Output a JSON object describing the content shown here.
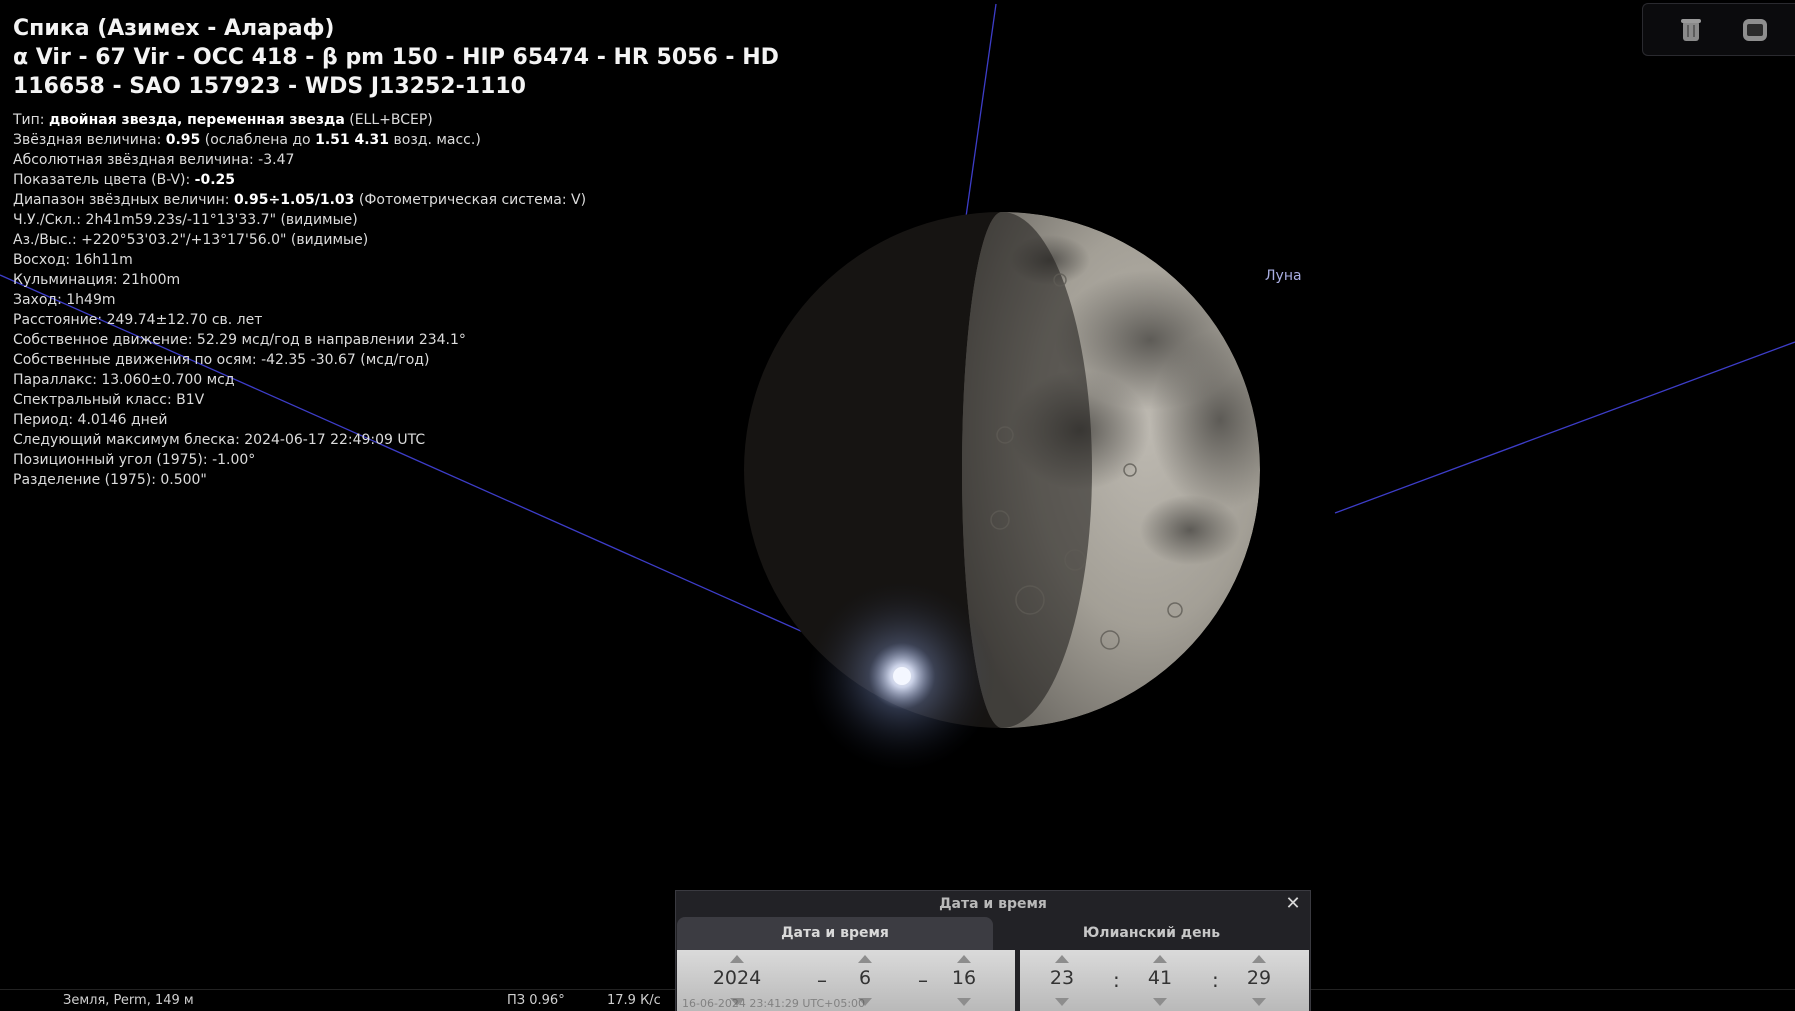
{
  "object": {
    "title": "Спика (Азимех - Алараф)",
    "designations": "α Vir - 67 Vir - OCC 418 - β pm 150 - HIP 65474 - HR 5056 - HD 116658 - SAO 157923 - WDS J13252-1110"
  },
  "info": {
    "type_label": "Тип: ",
    "type_value": "двойная звезда, переменная звезда",
    "type_extra": " (ELL+BCEP)",
    "mag_label": "Звёздная величина: ",
    "mag_value": "0.95",
    "mag_mid": " (ослаблена до ",
    "mag_ext": "1.51 4.31",
    "mag_tail": " возд. масс.)",
    "absmag": "Абсолютная звёздная величина: -3.47",
    "bv_label": "Показатель цвета (B-V): ",
    "bv_value": "-0.25",
    "range_label": "Диапазон звёздных величин: ",
    "range_value": "0.95÷1.05/1.03",
    "range_tail": " (Фотометрическая система: V)",
    "radec": "Ч.У./Скл.: 2h41m59.23s/-11°13'33.7\" (видимые)",
    "azalt": "Аз./Выс.: +220°53'03.2\"/+13°17'56.0\" (видимые)",
    "rise": "Восход: 16h11m",
    "transit": "Кульминация: 21h00m",
    "set": "Заход: 1h49m",
    "distance": "Расстояние: 249.74±12.70 св. лет",
    "proper_motion": "Собственное движение: 52.29 мсд/год в направлении 234.1°",
    "proper_motion_axes": "Собственные движения по осям: -42.35 -30.67 (мсд/год)",
    "parallax": "Параллакс: 13.060±0.700 мсд",
    "spectral": "Спектральный класс: B1V",
    "period": "Период: 4.0146 дней",
    "next_max": "Следующий максимум блеска: 2024-06-17 22:49:09 UTC",
    "pos_angle": "Позиционный угол (1975): -1.00°",
    "separation": "Разделение (1975): 0.500\""
  },
  "moon_label": "Луна",
  "top_buttons": {
    "left_icon": "trash-icon",
    "right_icon": "window-icon"
  },
  "status": {
    "location": "Земля, Perm, 149 м",
    "fov": "ПЗ 0.96°",
    "fps": "17.9 К/с",
    "datetime": "16-06-2024 23:41:29 UTC+05:00"
  },
  "dialog": {
    "title": "Дата и время",
    "tab_date": "Дата и время",
    "tab_julian": "Юлианский день",
    "year": "2024",
    "month": "6",
    "day": "16",
    "hour": "23",
    "minute": "41",
    "second": "29",
    "date_sep": "–",
    "time_sep": ":"
  },
  "colors": {
    "background": "#000000",
    "grid_line": "#3d3dc8",
    "moon_label": "#a9aee2",
    "star_glow": "#bfd0ff"
  }
}
